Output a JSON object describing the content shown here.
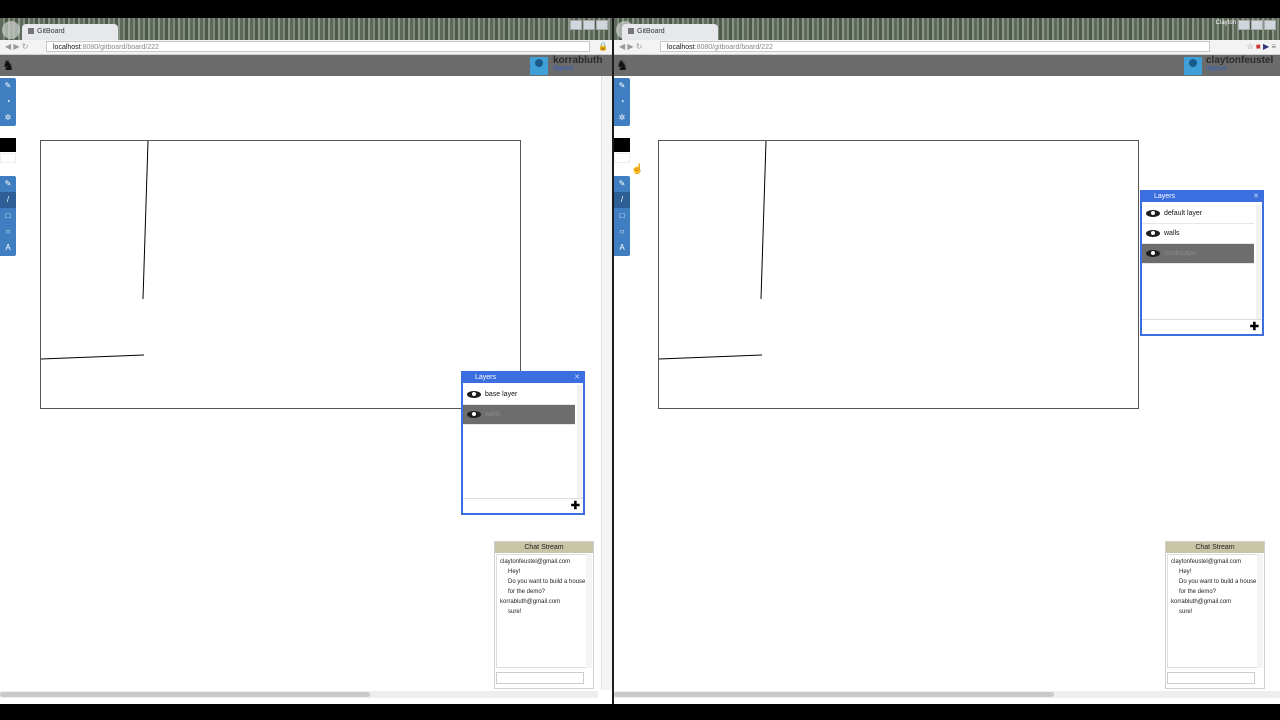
{
  "left": {
    "tab_title": "GitBoard",
    "url_host": "localhost",
    "url_path": ":8080/gitboard/board/222",
    "username": "korrabluth",
    "signout": "Signout",
    "layers_title": "Layers",
    "layers": [
      {
        "name": "base layer",
        "selected": false
      },
      {
        "name": "walls",
        "selected": true
      }
    ],
    "chat_title": "Chat Stream",
    "chat": [
      {
        "from": "claytonfeustel@gmail.com",
        "text": "Hey!"
      },
      {
        "from": "",
        "text": "Do you want to build a house for the demo?"
      },
      {
        "from": "korrabluth@gmail.com",
        "text": "sure!"
      }
    ]
  },
  "right": {
    "tab_title": "GitBoard",
    "user_chip": "Clayton",
    "url_host": "localhost",
    "url_path": ":8080/gitboard/board/222",
    "username": "claytonfeustel",
    "signout": "Signout",
    "layers_title": "Layers",
    "layers": [
      {
        "name": "default layer",
        "selected": false
      },
      {
        "name": "walls",
        "selected": false
      },
      {
        "name": "landscape",
        "selected": true
      }
    ],
    "chat_title": "Chat Stream",
    "chat": [
      {
        "from": "claytonfeustel@gmail.com",
        "text": "Hey!"
      },
      {
        "from": "",
        "text": "Do you want to build a house for the demo?"
      },
      {
        "from": "korrabluth@gmail.com",
        "text": "sure!"
      }
    ]
  },
  "icons": {
    "pencil": "✎",
    "fill": "◔",
    "gear": "✲",
    "line": "/",
    "rect": "□",
    "circle": "○",
    "text": "A",
    "plus": "✚",
    "close": "✕",
    "dino": "♞",
    "lock": "🔒",
    "star": "☆"
  }
}
